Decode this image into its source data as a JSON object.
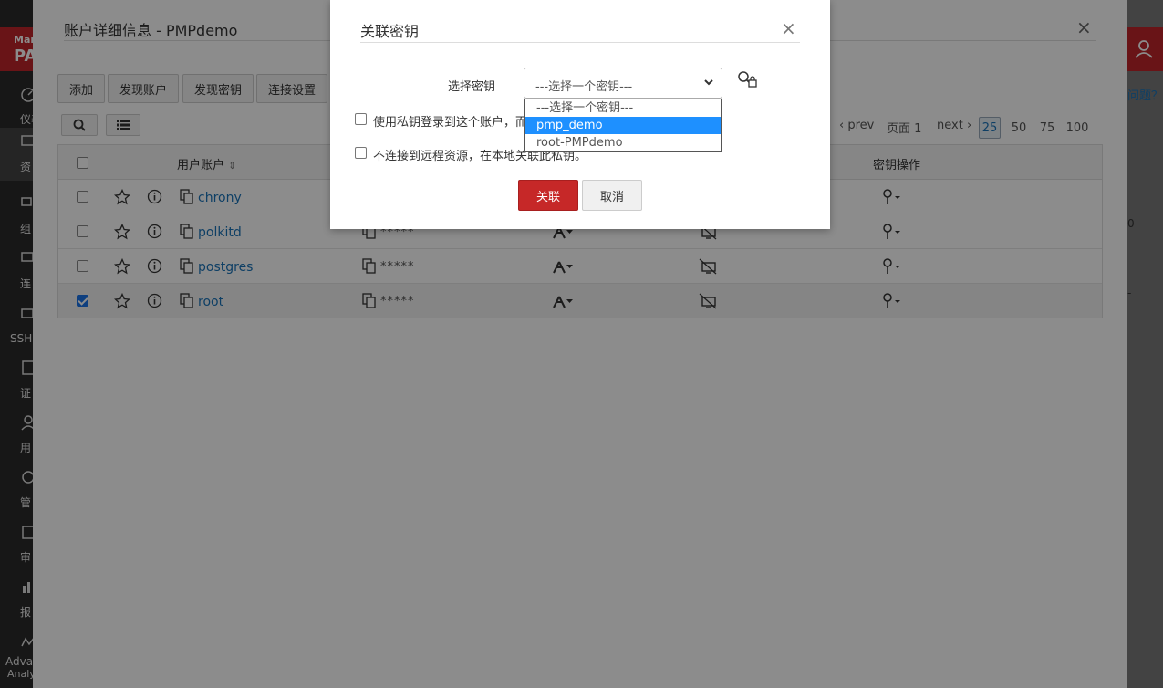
{
  "app": {
    "brand_line1": "Mar",
    "brand_line2": "PA",
    "sidebar": [
      {
        "icon": "dashboard-icon",
        "label": "仪表"
      },
      {
        "icon": "resources-icon",
        "label": "资"
      },
      {
        "icon": "groups-icon",
        "label": "组"
      },
      {
        "icon": "connections-icon",
        "label": "连"
      },
      {
        "icon": "ssh-icon",
        "label": "SSH"
      },
      {
        "icon": "certificates-icon",
        "label": "证"
      },
      {
        "icon": "users-icon",
        "label": "用"
      },
      {
        "icon": "admin-icon",
        "label": "管"
      },
      {
        "icon": "audit-icon",
        "label": "审"
      },
      {
        "icon": "reports-icon",
        "label": "报"
      },
      {
        "icon": "advanced-icon",
        "label": "Adva"
      },
      {
        "icon": "",
        "label": "Analy"
      }
    ],
    "help_text": "问题？",
    "right_fragments": [
      "0",
      "-"
    ]
  },
  "panel": {
    "title": "账户详细信息 - PMPdemo",
    "toolbar": {
      "add": "添加",
      "discover_accounts": "发现账户",
      "discover_keys": "发现密钥",
      "connection_settings": "连接设置"
    },
    "pager": {
      "prev": "prev",
      "page_label": "页面 1",
      "next": "next",
      "sizes": [
        "25",
        "50",
        "75",
        "100"
      ],
      "selected_size": "25"
    },
    "columns": {
      "user_account": "用户账户",
      "key_actions": "密钥操作"
    },
    "rows": [
      {
        "account": "chrony",
        "password": "*****",
        "checked": false
      },
      {
        "account": "polkitd",
        "password": "*****",
        "checked": false
      },
      {
        "account": "postgres",
        "password": "*****",
        "checked": false
      },
      {
        "account": "root",
        "password": "*****",
        "checked": true
      }
    ]
  },
  "modal": {
    "title": "关联密钥",
    "close": "×",
    "select_label": "选择密钥",
    "select_value": "---选择一个密钥---",
    "option_login": "使用私钥登录到这个账户，而",
    "option_no_connect": "不连接到远程资源，在本地关联此私钥。",
    "link_button": "关联",
    "cancel_button": "取消",
    "dropdown_options": [
      "---选择一个密钥---",
      "pmp_demo",
      "root-PMPdemo"
    ],
    "dropdown_selected": "pmp_demo"
  },
  "colors": {
    "brand_red": "#c0262b",
    "primary_button": "#c62828",
    "link_blue": "#1a73b8",
    "highlight_blue": "#1e90ff"
  }
}
